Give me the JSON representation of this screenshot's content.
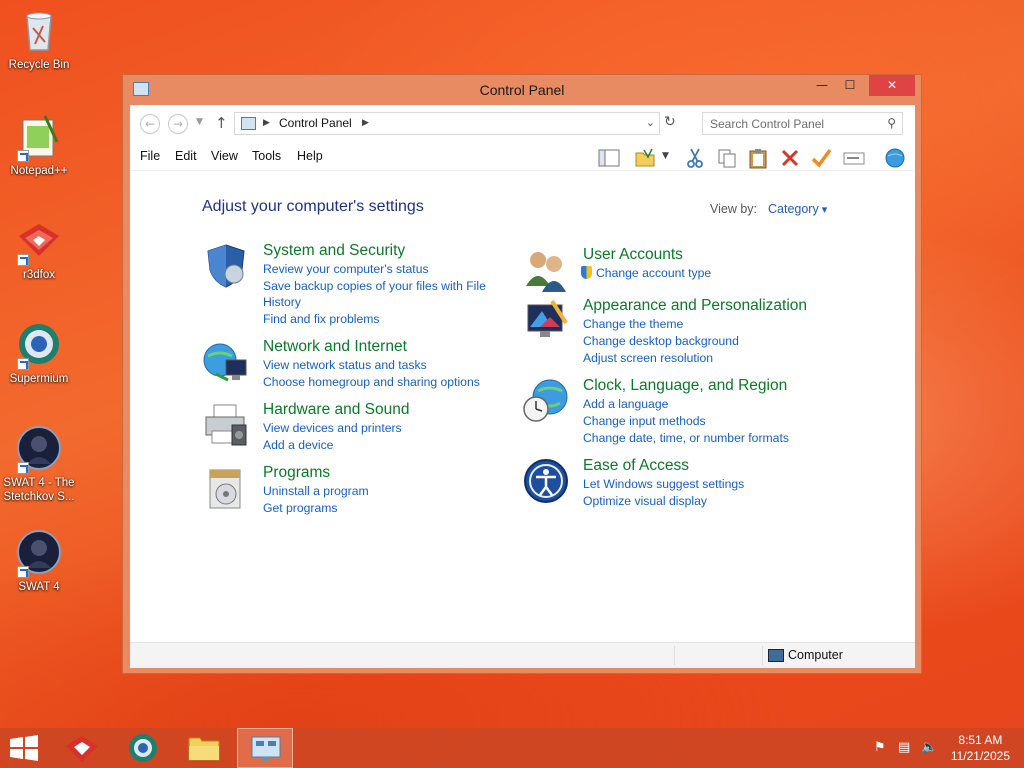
{
  "desktop": {
    "icons": [
      {
        "label": "Recycle Bin"
      },
      {
        "label": "Notepad++"
      },
      {
        "label": "r3dfox"
      },
      {
        "label": "Supermium"
      },
      {
        "label": "SWAT 4 - The Stetchkov S..."
      },
      {
        "label": "SWAT 4"
      }
    ]
  },
  "window": {
    "title": "Control Panel",
    "controls": {
      "minimize": "—",
      "maximize": "☐",
      "close": "✕"
    }
  },
  "address_bar": {
    "breadcrumb": "Control Panel",
    "search_placeholder": "Search Control Panel"
  },
  "menu": {
    "items": [
      "File",
      "Edit",
      "View",
      "Tools",
      "Help"
    ]
  },
  "toolbar_icons": [
    "layout-icon",
    "folder-options-icon",
    "cut-icon",
    "copy-icon",
    "paste-icon",
    "delete-icon",
    "check-icon",
    "properties-icon",
    "globe-icon"
  ],
  "content": {
    "heading": "Adjust your computer's settings",
    "view_by_label": "View by:",
    "view_by_value": "Category",
    "categories": [
      {
        "title": "System and Security",
        "icon": "shield-icon",
        "links": [
          "Review your computer's status",
          "Save backup copies of your files with File History",
          "Find and fix problems"
        ]
      },
      {
        "title": "Network and Internet",
        "icon": "network-icon",
        "links": [
          "View network status and tasks",
          "Choose homegroup and sharing options"
        ]
      },
      {
        "title": "Hardware and Sound",
        "icon": "printer-icon",
        "links": [
          "View devices and printers",
          "Add a device"
        ]
      },
      {
        "title": "Programs",
        "icon": "programs-icon",
        "links": [
          "Uninstall a program",
          "Get programs"
        ]
      },
      {
        "title": "User Accounts",
        "icon": "users-icon",
        "links": [
          "Change account type"
        ]
      },
      {
        "title": "Appearance and Personalization",
        "icon": "display-icon",
        "links": [
          "Change the theme",
          "Change desktop background",
          "Adjust screen resolution"
        ]
      },
      {
        "title": "Clock, Language, and Region",
        "icon": "clock-globe-icon",
        "links": [
          "Add a language",
          "Change input methods",
          "Change date, time, or number formats"
        ]
      },
      {
        "title": "Ease of Access",
        "icon": "ease-of-access-icon",
        "links": [
          "Let Windows suggest settings",
          "Optimize visual display"
        ]
      }
    ]
  },
  "status_bar": {
    "computer_label": "Computer"
  },
  "taskbar": {
    "time": "8:51 AM",
    "date": "11/21/2025"
  },
  "colors": {
    "accent": "#e8461c",
    "link": "#1660c3",
    "category_title": "#0a7a28",
    "heading": "#1e3287"
  }
}
